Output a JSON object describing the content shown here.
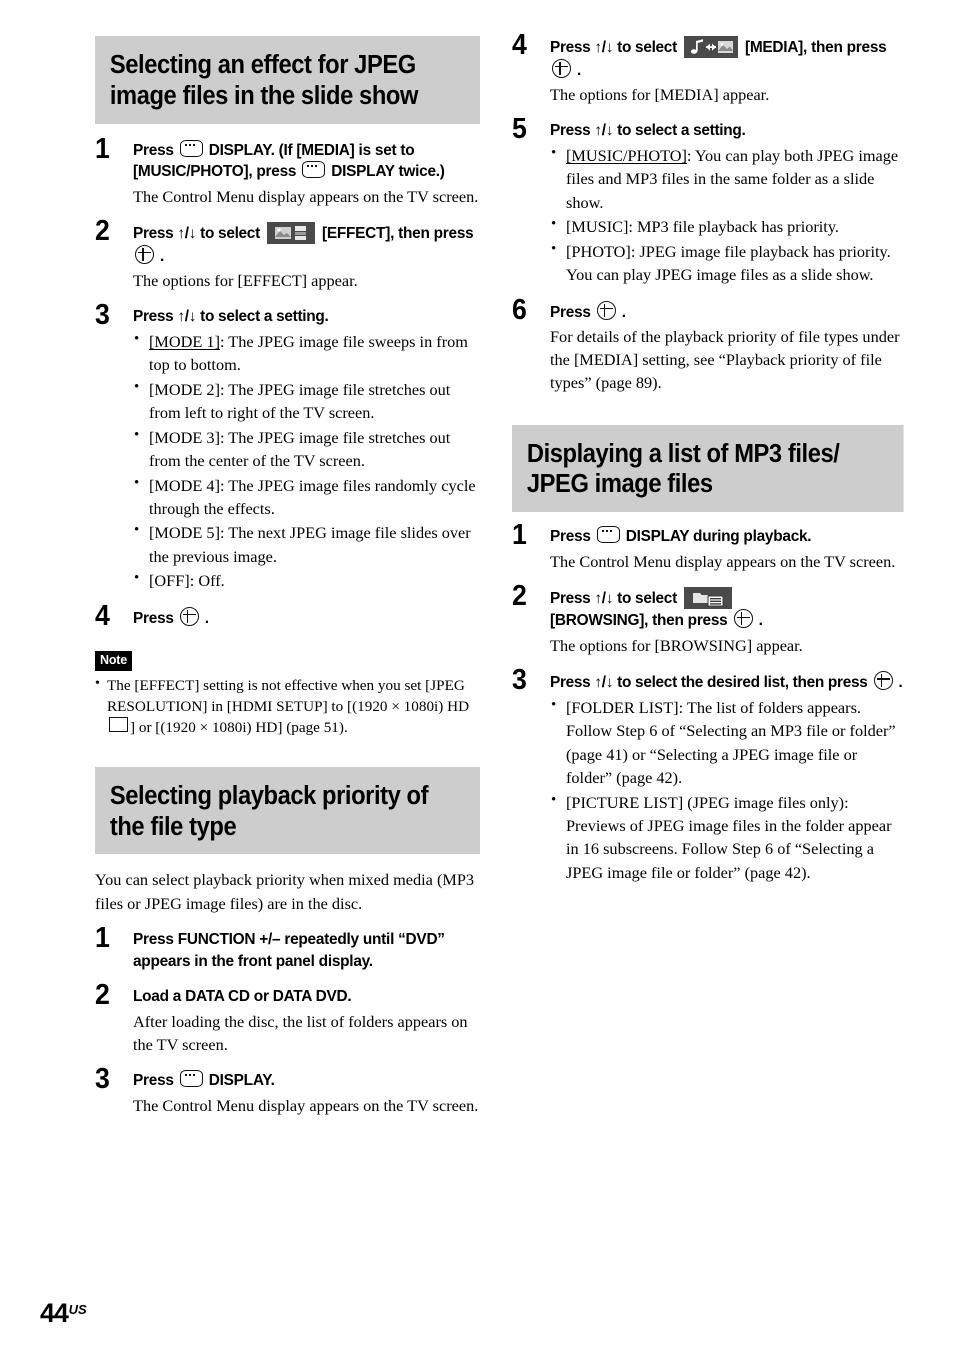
{
  "page": {
    "number": "44",
    "region": "US"
  },
  "left_column": {
    "section1": {
      "heading": "Selecting an effect for JPEG image files in the slide show",
      "steps": [
        {
          "num": "1",
          "title_parts": {
            "a": "Press",
            "b": "DISPLAY. (If [MEDIA] is set to [MUSIC/PHOTO], press",
            "c": "DISPLAY twice.)"
          },
          "body": "The Control Menu display appears on the TV screen."
        },
        {
          "num": "2",
          "title_parts": {
            "a": "Press ↑/↓ to select",
            "b": "[EFFECT], then press",
            "c": "."
          },
          "body": "The options for [EFFECT] appear."
        },
        {
          "num": "3",
          "title": "Press ↑/↓ to select a setting.",
          "options": [
            {
              "label": "[MODE 1]",
              "underlined": true,
              "text": ": The JPEG image file sweeps in from top to bottom."
            },
            {
              "label": "[MODE 2]",
              "underlined": false,
              "text": ": The JPEG image file stretches out from left to right of the TV screen."
            },
            {
              "label": "[MODE 3]",
              "underlined": false,
              "text": ": The JPEG image file stretches out from the center of the TV screen."
            },
            {
              "label": "[MODE 4]",
              "underlined": false,
              "text": ": The JPEG image files randomly cycle through the effects."
            },
            {
              "label": "[MODE 5]",
              "underlined": false,
              "text": ": The next JPEG image file slides over the previous image."
            },
            {
              "label": "[OFF]",
              "underlined": false,
              "text": ": Off."
            }
          ]
        },
        {
          "num": "4",
          "title_parts": {
            "a": "Press",
            "c": "."
          }
        }
      ],
      "note": {
        "tag": "Note",
        "text_a": "The [EFFECT] setting is not effective when you set [JPEG RESOLUTION] in [HDMI SETUP] to [(1920 × 1080i) HD",
        "text_b": "] or [(1920 × 1080i) HD] (page 51)."
      }
    },
    "section2": {
      "heading": "Selecting playback priority of the file type",
      "intro": "You can select playback priority when mixed media (MP3 files or JPEG image files) are in the disc.",
      "steps": [
        {
          "num": "1",
          "title": "Press FUNCTION +/– repeatedly until “DVD” appears in the front panel display."
        },
        {
          "num": "2",
          "title": "Load a DATA CD or DATA DVD.",
          "body": "After loading the disc, the list of folders appears on the TV screen."
        },
        {
          "num": "3",
          "title_parts": {
            "a": "Press",
            "c": "DISPLAY."
          },
          "body": "The Control Menu display appears on the TV screen."
        }
      ]
    }
  },
  "right_column": {
    "section1_continued": {
      "steps": [
        {
          "num": "4",
          "title_parts": {
            "a": "Press ↑/↓ to select",
            "b": "[MEDIA], then press",
            "c": "."
          },
          "body": "The options for [MEDIA] appear."
        },
        {
          "num": "5",
          "title": "Press ↑/↓ to select a setting.",
          "options": [
            {
              "label": "[MUSIC/PHOTO]",
              "underlined": true,
              "text": ": You can play both JPEG image files and MP3 files in the same folder as a slide show."
            },
            {
              "label": "[MUSIC]",
              "underlined": false,
              "text": ": MP3 file playback has priority."
            },
            {
              "label": "[PHOTO]",
              "underlined": false,
              "text": ": JPEG image file playback has priority. You can play JPEG image files as a slide show."
            }
          ]
        },
        {
          "num": "6",
          "title_parts": {
            "a": "Press",
            "c": "."
          },
          "body": "For details of the playback priority of file types under the [MEDIA] setting, see “Playback priority of file types” (page 89)."
        }
      ]
    },
    "section2": {
      "heading": "Displaying a list of MP3 files/ JPEG image files",
      "steps": [
        {
          "num": "1",
          "title_parts": {
            "a": "Press",
            "c": "DISPLAY during playback."
          },
          "body": "The Control Menu display appears on the TV screen."
        },
        {
          "num": "2",
          "title_parts": {
            "a": "Press ↑/↓ to select",
            "b": "[BROWSING], then press",
            "c": "."
          },
          "body": "The options for [BROWSING] appear."
        },
        {
          "num": "3",
          "title_parts": {
            "a": "Press ↑/↓ to select the desired list, then press",
            "c": "."
          },
          "options": [
            {
              "label": "[FOLDER LIST]",
              "underlined": false,
              "text": ": The list of folders appears. Follow Step 6 of “Selecting an MP3 file or folder” (page 41) or “Selecting a JPEG image file or folder” (page 42)."
            },
            {
              "label": "[PICTURE LIST]",
              "underlined": false,
              "text": " (JPEG image files only): Previews of JPEG image files in the folder appear in 16 subscreens. Follow Step 6 of “Selecting a JPEG image file or folder” (page 42)."
            }
          ]
        }
      ]
    }
  },
  "icons": {
    "display": "display-remote-button-icon",
    "enter": "enter-button-icon",
    "effect": "effect-control-menu-icon",
    "media": "media-control-menu-icon",
    "browsing": "browsing-control-menu-icon",
    "hdmi_square": "hdmi-resolution-square-icon"
  }
}
